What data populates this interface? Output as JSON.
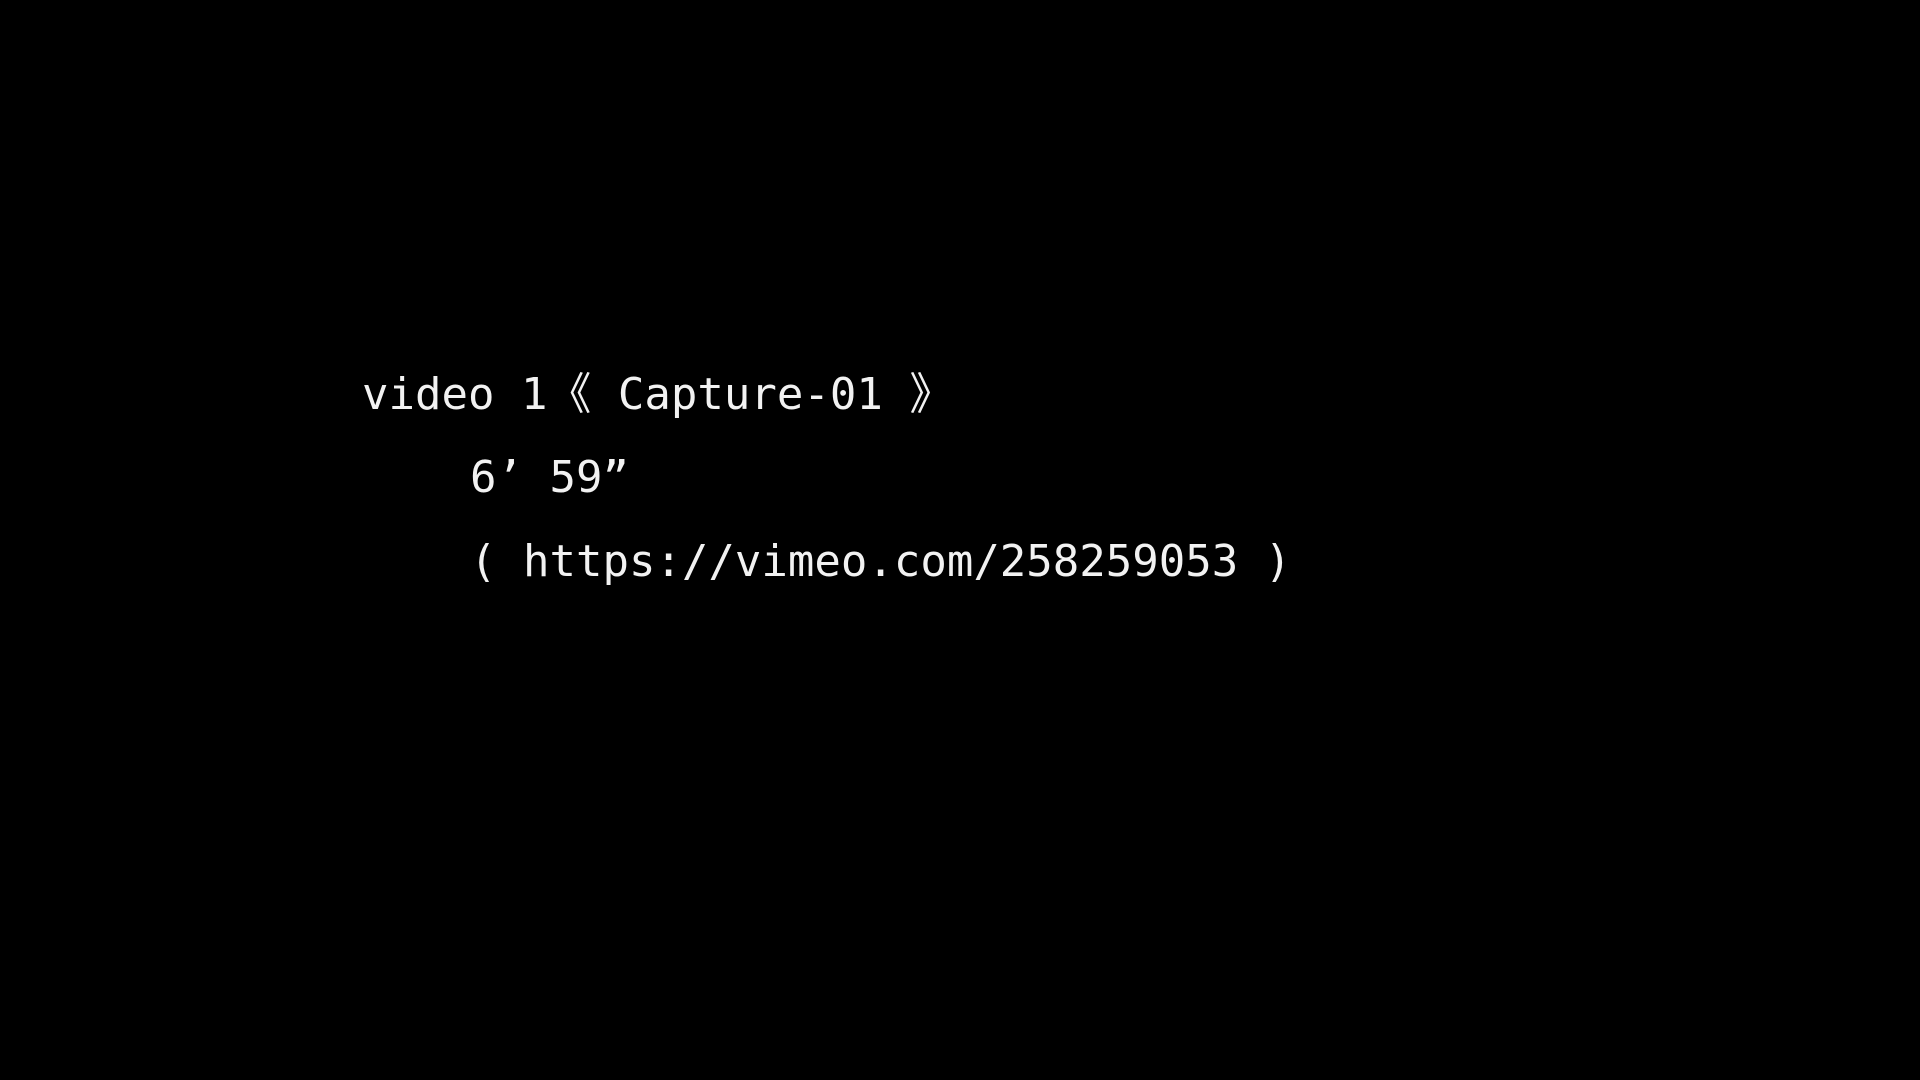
{
  "slide": {
    "title": "video 1《 Capture-01 》",
    "duration": "6’ 59”",
    "link": "( https://vimeo.com/258259053 )"
  },
  "colors": {
    "background": "#000000",
    "text": "#f2f2f2"
  }
}
